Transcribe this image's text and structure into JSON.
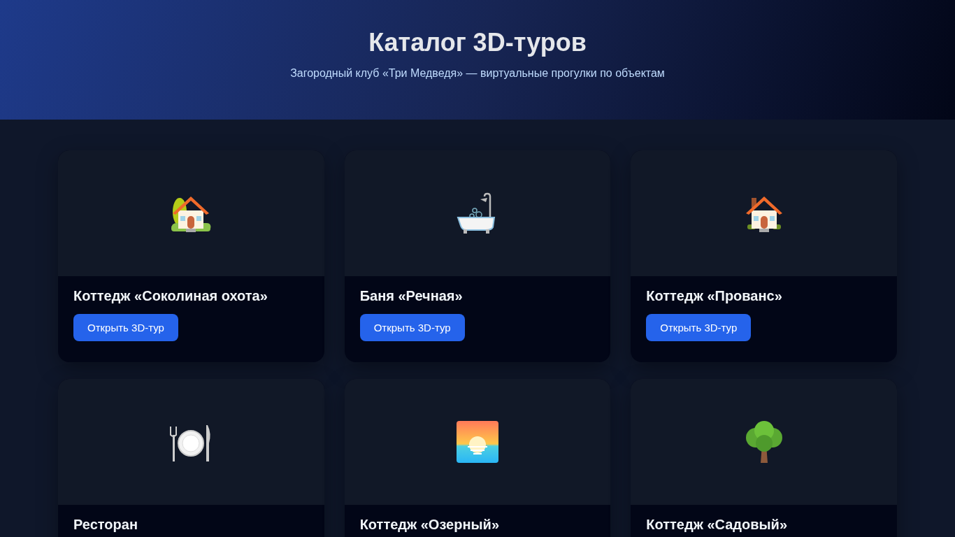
{
  "header": {
    "title": "Каталог 3D-туров",
    "subtitle": "Загородный клуб «Три Медведя» — виртуальные прогулки по объектам"
  },
  "cards": [
    {
      "kind": "house-garden",
      "title": "Коттедж «Соколиная охота»",
      "button": "Открыть 3D-тур"
    },
    {
      "kind": "bathtub",
      "title": "Баня «Речная»",
      "button": "Открыть 3D-тур"
    },
    {
      "kind": "house",
      "title": "Коттедж «Прованс»",
      "button": "Открыть 3D-тур"
    },
    {
      "kind": "dining",
      "title": "Ресторан"
    },
    {
      "kind": "sunrise",
      "title": "Коттедж «Озерный»"
    },
    {
      "kind": "tree",
      "title": "Коттедж «Садовый»"
    }
  ]
}
